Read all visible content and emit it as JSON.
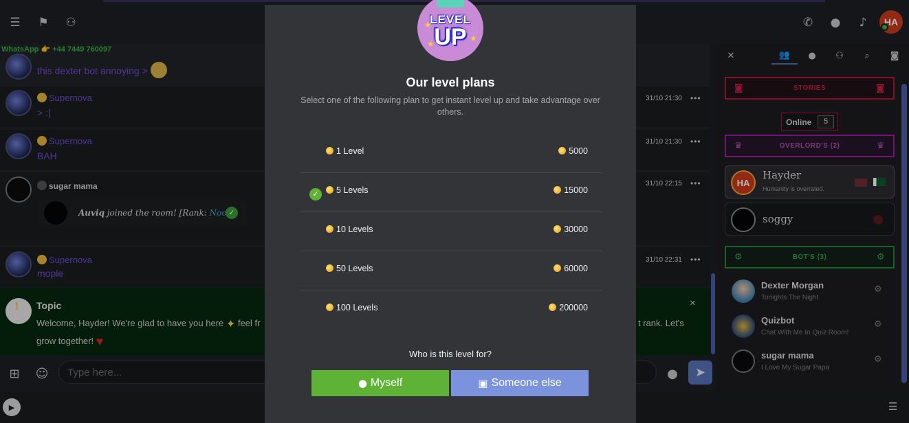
{
  "topbar": {
    "left_icons": [
      "menu-icon",
      "flag-icon",
      "user-shield-icon"
    ],
    "right_icons": [
      "phone-plus-icon",
      "chat-bubble-icon",
      "bell-icon"
    ],
    "avatar_initials": "HA"
  },
  "chat": {
    "whatsapp_line": "WhatsApp 👉 +44 7449 760097",
    "messages": [
      {
        "name": "",
        "text": "this dexter bot annoying >",
        "time": "",
        "more": ""
      },
      {
        "name": "Supernova",
        "text": "> :|",
        "time": "31/10 21:30",
        "more": "•••"
      },
      {
        "name": "Supernova",
        "text": "BAH",
        "time": "31/10 21:30",
        "more": "•••"
      },
      {
        "name": "sugar mama",
        "text": "",
        "time": "31/10 22:15",
        "more": "•••"
      },
      {
        "name": "Supernova",
        "text": "mople",
        "time": "31/10 22:31",
        "more": "•••"
      }
    ],
    "join": {
      "user": "Auviq",
      "text_a": "joined the room! [Rank:",
      "rank": "Noob",
      "text_b": "]"
    },
    "topic": {
      "title": "Topic",
      "line1": "Welcome, Hayder! We're glad to have you here",
      "line1_cont": "feel fr",
      "line1_right": "t rank. Let's",
      "line2": "grow together!",
      "close": "×"
    }
  },
  "input": {
    "placeholder": "Type here...",
    "icons": [
      "plus-square-icon",
      "smile-icon",
      "mic-icon",
      "send-icon"
    ]
  },
  "right_panel": {
    "tabs": [
      "close-icon",
      "users-icon",
      "user-icon",
      "user-shield-icon",
      "search-icon",
      "camera-icon"
    ],
    "stories_label": "STORIES",
    "online_label": "Online",
    "online_count": "5",
    "overlords_label": "OVERLORD'S (2)",
    "overlords": [
      {
        "name": "Hayder",
        "mood": "Humanity is overrated.",
        "initials": "HA"
      },
      {
        "name": "soggy",
        "mood": ""
      }
    ],
    "bots_label": "BOT'S (3)",
    "bots": [
      {
        "name": "Dexter Morgan",
        "mood": "Tonights The Night"
      },
      {
        "name": "Quizbot",
        "mood": "Chat With Me In Quiz Room!"
      },
      {
        "name": "sugar mama",
        "mood": "I Love My Sugar Papa"
      }
    ]
  },
  "modal": {
    "logo_top": "LEVEL",
    "logo_bottom": "UP",
    "title": "Our level plans",
    "subtitle": "Select one of the following plan to get instant level up and take advantage over others.",
    "plans": [
      {
        "label": "1 Level",
        "price": "5000",
        "selected": false
      },
      {
        "label": "5 Levels",
        "price": "15000",
        "selected": true
      },
      {
        "label": "10 Levels",
        "price": "30000",
        "selected": false
      },
      {
        "label": "50 Levels",
        "price": "60000",
        "selected": false
      },
      {
        "label": "100 Levels",
        "price": "200000",
        "selected": false
      }
    ],
    "who_label": "Who is this level for?",
    "btn_myself": "Myself",
    "btn_someone": "Someone else"
  },
  "colors": {
    "accent_blue": "#5872b8",
    "green": "#5eb336",
    "stories_red": "#b5163c",
    "overlord_purple": "#a318a5",
    "bots_green": "#1b8a3d",
    "modal_bg": "#333438"
  }
}
